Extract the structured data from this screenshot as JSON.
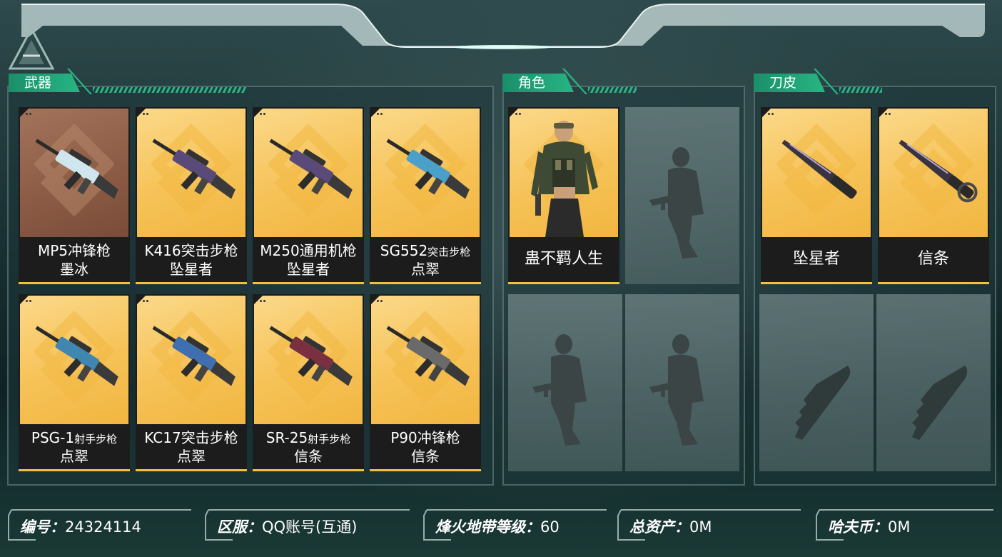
{
  "panels": {
    "weapons": {
      "title": "武器"
    },
    "characters": {
      "title": "角色"
    },
    "knife_skins": {
      "title": "刀皮"
    }
  },
  "weapons": [
    {
      "line1": "MP5冲锋枪",
      "line1_small": "",
      "line2": "墨冰",
      "icon": "smg-icon",
      "bg": "brown"
    },
    {
      "line1": "K416突击步枪",
      "line1_small": "",
      "line2": "坠星者",
      "icon": "rifle-icon",
      "bg": "gold"
    },
    {
      "line1": "M250通用机枪",
      "line1_small": "",
      "line2": "坠星者",
      "icon": "machine-gun-icon",
      "bg": "gold"
    },
    {
      "line1": "SG552",
      "line1_small": "突击步枪",
      "line2": "点翠",
      "icon": "rifle-icon",
      "bg": "gold"
    },
    {
      "line1": "PSG-1",
      "line1_small": "射手步枪",
      "line2": "点翠",
      "icon": "sniper-rifle-icon",
      "bg": "gold"
    },
    {
      "line1": "KC17突击步枪",
      "line1_small": "",
      "line2": "点翠",
      "icon": "rifle-icon",
      "bg": "gold"
    },
    {
      "line1": "SR-25",
      "line1_small": "射手步枪",
      "line2": "信条",
      "icon": "sniper-rifle-icon",
      "bg": "gold"
    },
    {
      "line1": "P90冲锋枪",
      "line1_small": "",
      "line2": "信条",
      "icon": "smg-icon",
      "bg": "gold"
    }
  ],
  "characters": [
    {
      "name": "蛊不羁人生",
      "icon": "operator-portrait-icon"
    }
  ],
  "knives": [
    {
      "name": "坠星者",
      "icon": "knife-icon"
    },
    {
      "name": "信条",
      "icon": "knife-icon"
    }
  ],
  "footer": {
    "id": {
      "label": "编号：",
      "value": "24324114"
    },
    "server": {
      "label": "区服：",
      "value": "QQ账号(互通)"
    },
    "level": {
      "label": "烽火地带等级：",
      "value": "60"
    },
    "assets": {
      "label": "总资产：",
      "value": "0M"
    },
    "currency": {
      "label": "哈夫币：",
      "value": "0M"
    }
  },
  "colors": {
    "accent": "#27b583",
    "card_gold": "#f6c257",
    "card_brown": "#8a5a44",
    "background": "#1b3133"
  }
}
